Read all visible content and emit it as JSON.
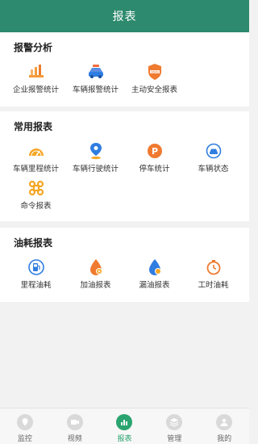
{
  "header": {
    "title": "报表"
  },
  "sections": [
    {
      "title": "报警分析",
      "items": [
        {
          "label": "企业报警统计",
          "icon": "bar-chart-icon"
        },
        {
          "label": "车辆报警统计",
          "icon": "car-alert-icon"
        },
        {
          "label": "主动安全报表",
          "icon": "adas-shield-icon"
        }
      ]
    },
    {
      "title": "常用报表",
      "items": [
        {
          "label": "车辆里程统计",
          "icon": "speedometer-icon"
        },
        {
          "label": "车辆行驶统计",
          "icon": "location-pin-icon"
        },
        {
          "label": "停车统计",
          "icon": "parking-icon"
        },
        {
          "label": "车辆状态",
          "icon": "car-status-icon"
        },
        {
          "label": "命令报表",
          "icon": "command-icon"
        }
      ]
    },
    {
      "title": "油耗报表",
      "items": [
        {
          "label": "里程油耗",
          "icon": "fuel-pump-icon"
        },
        {
          "label": "加油报表",
          "icon": "fuel-drop-icon"
        },
        {
          "label": "漏油报表",
          "icon": "leak-drop-icon"
        },
        {
          "label": "工时油耗",
          "icon": "timer-icon"
        }
      ]
    }
  ],
  "bottom_nav": [
    {
      "label": "监控",
      "active": false
    },
    {
      "label": "视频",
      "active": false
    },
    {
      "label": "报表",
      "active": true
    },
    {
      "label": "管理",
      "active": false
    },
    {
      "label": "我的",
      "active": false
    }
  ],
  "colors": {
    "header": "#2d8a6e",
    "accent_orange": "#f39c3b",
    "accent_blue": "#2f7de1",
    "active_nav": "#2aa46f"
  }
}
